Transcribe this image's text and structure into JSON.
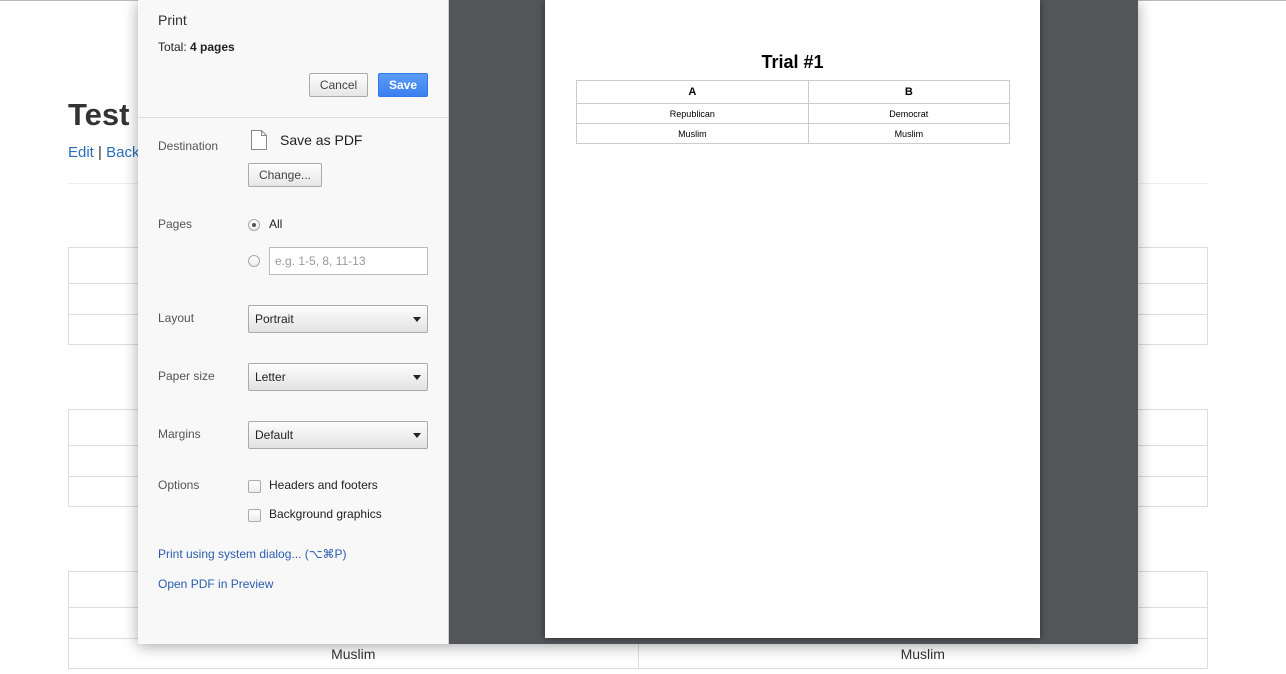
{
  "background": {
    "title": "Test",
    "links": {
      "edit": "Edit",
      "separator": "|",
      "back": "Back"
    },
    "tables": [
      {
        "rows": [
          [
            "",
            ""
          ],
          [
            "",
            ""
          ],
          [
            "",
            ""
          ]
        ]
      },
      {
        "rows": [
          [
            "",
            ""
          ],
          [
            "",
            ""
          ],
          [
            "",
            ""
          ]
        ]
      },
      {
        "rows": [
          [
            "",
            ""
          ],
          [
            "",
            ""
          ],
          [
            "Muslim",
            "Muslim"
          ]
        ]
      }
    ]
  },
  "dialog": {
    "title": "Print",
    "total_label": "Total:",
    "total_value": "4 pages",
    "cancel_label": "Cancel",
    "save_label": "Save",
    "destination": {
      "label": "Destination",
      "icon": "pdf-file-icon",
      "value": "Save as PDF",
      "change_label": "Change..."
    },
    "pages": {
      "label": "Pages",
      "all_label": "All",
      "selected": "all",
      "range_placeholder": "e.g. 1-5, 8, 11-13",
      "range_value": ""
    },
    "layout": {
      "label": "Layout",
      "value": "Portrait"
    },
    "paper_size": {
      "label": "Paper size",
      "value": "Letter"
    },
    "margins": {
      "label": "Margins",
      "value": "Default"
    },
    "options": {
      "label": "Options",
      "headers_footers": {
        "label": "Headers and footers",
        "checked": false
      },
      "background_graphics": {
        "label": "Background graphics",
        "checked": false
      }
    },
    "system_dialog_link": "Print using system dialog... (⌥⌘P)",
    "open_pdf_link": "Open PDF in Preview"
  },
  "preview": {
    "title": "Trial #1",
    "headers": [
      "A",
      "B"
    ],
    "rows": [
      [
        "Republican",
        "Democrat"
      ],
      [
        "Muslim",
        "Muslim"
      ]
    ]
  },
  "colors": {
    "link": "#2a5db0",
    "save_button": "#3b7ff0",
    "preview_background": "#525659",
    "sidebar_background": "#f8f8f8"
  }
}
